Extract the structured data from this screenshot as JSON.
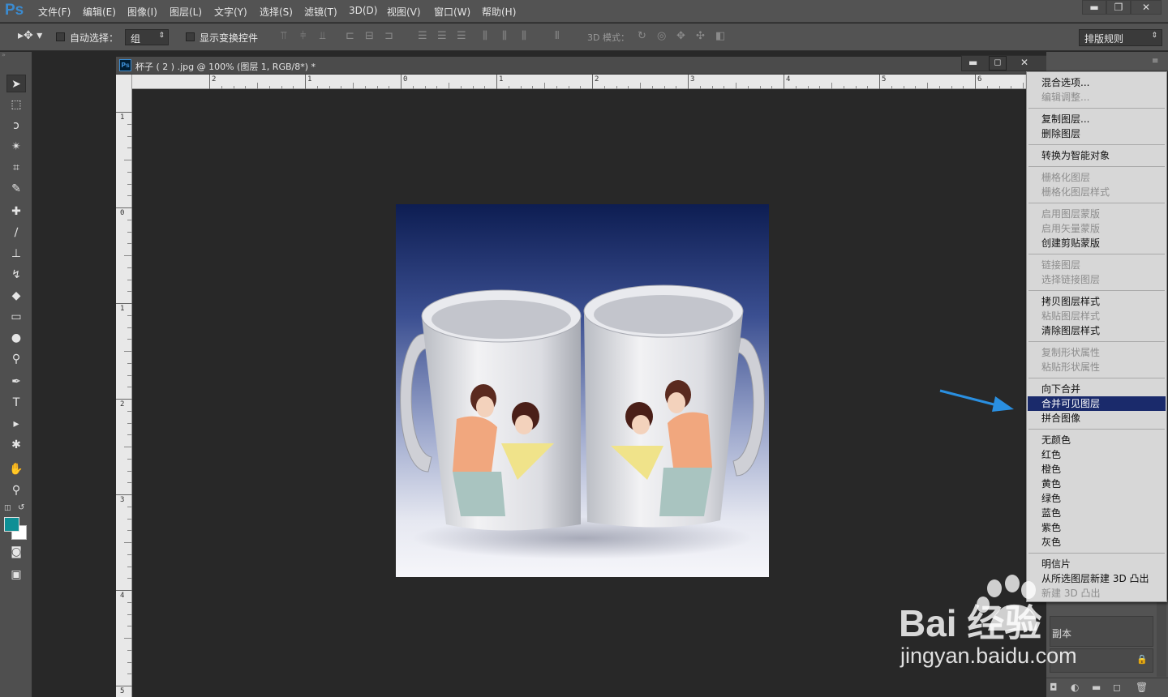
{
  "app": {
    "logo": "Ps"
  },
  "menubar": {
    "items": [
      "文件(F)",
      "编辑(E)",
      "图像(I)",
      "图层(L)",
      "文字(Y)",
      "选择(S)",
      "滤镜(T)",
      "3D(D)",
      "视图(V)",
      "窗口(W)",
      "帮助(H)"
    ]
  },
  "window_controls": {
    "minimize": "▬",
    "restore": "❐",
    "close": "✕"
  },
  "options_bar": {
    "auto_select_label": "自动选择：",
    "auto_select_value": "组",
    "show_transform_label": "显示变换控件",
    "mode_3d_label": "3D 模式：",
    "workspace_value": "排版规则"
  },
  "document": {
    "tab_icon": "Ps",
    "tab_title": "杯子 ( 2 ) .jpg @ 100% (图层 1, RGB/8*) *",
    "h_ruler_labels": [
      "2",
      "1",
      "0",
      "1",
      "2",
      "3",
      "4",
      "5",
      "6"
    ],
    "v_ruler_labels": [
      "1",
      "0",
      "1",
      "2",
      "3",
      "4",
      "5"
    ]
  },
  "context_menu": {
    "groups": [
      [
        {
          "label": "混合选项...",
          "enabled": true
        },
        {
          "label": "编辑调整...",
          "enabled": false
        }
      ],
      [
        {
          "label": "复制图层...",
          "enabled": true
        },
        {
          "label": "删除图层",
          "enabled": true
        }
      ],
      [
        {
          "label": "转换为智能对象",
          "enabled": true
        }
      ],
      [
        {
          "label": "栅格化图层",
          "enabled": false
        },
        {
          "label": "栅格化图层样式",
          "enabled": false
        }
      ],
      [
        {
          "label": "启用图层蒙版",
          "enabled": false
        },
        {
          "label": "启用矢量蒙版",
          "enabled": false
        },
        {
          "label": "创建剪贴蒙版",
          "enabled": true
        }
      ],
      [
        {
          "label": "链接图层",
          "enabled": false
        },
        {
          "label": "选择链接图层",
          "enabled": false
        }
      ],
      [
        {
          "label": "拷贝图层样式",
          "enabled": true
        },
        {
          "label": "粘贴图层样式",
          "enabled": false
        },
        {
          "label": "清除图层样式",
          "enabled": true
        }
      ],
      [
        {
          "label": "复制形状属性",
          "enabled": false
        },
        {
          "label": "粘贴形状属性",
          "enabled": false
        }
      ],
      [
        {
          "label": "向下合并",
          "enabled": true
        },
        {
          "label": "合并可见图层",
          "enabled": true,
          "highlighted": true
        },
        {
          "label": "拼合图像",
          "enabled": true
        }
      ],
      [
        {
          "label": "无颜色",
          "enabled": true
        },
        {
          "label": "红色",
          "enabled": true
        },
        {
          "label": "橙色",
          "enabled": true
        },
        {
          "label": "黄色",
          "enabled": true
        },
        {
          "label": "绿色",
          "enabled": true
        },
        {
          "label": "蓝色",
          "enabled": true
        },
        {
          "label": "紫色",
          "enabled": true
        },
        {
          "label": "灰色",
          "enabled": true
        }
      ],
      [
        {
          "label": "明信片",
          "enabled": true
        },
        {
          "label": "从所选图层新建 3D 凸出",
          "enabled": true
        },
        {
          "label": "新建 3D 凸出",
          "enabled": false
        }
      ]
    ]
  },
  "layers_panel": {
    "row_label": "副本"
  },
  "watermark": {
    "brand": "Bai 经验",
    "url": "jingyan.baidu.com"
  },
  "colors": {
    "accent": "#1a2a6b",
    "foreground_swatch": "#0e8f95",
    "background_swatch": "#ffffff",
    "arrow": "#2a8fe0"
  }
}
